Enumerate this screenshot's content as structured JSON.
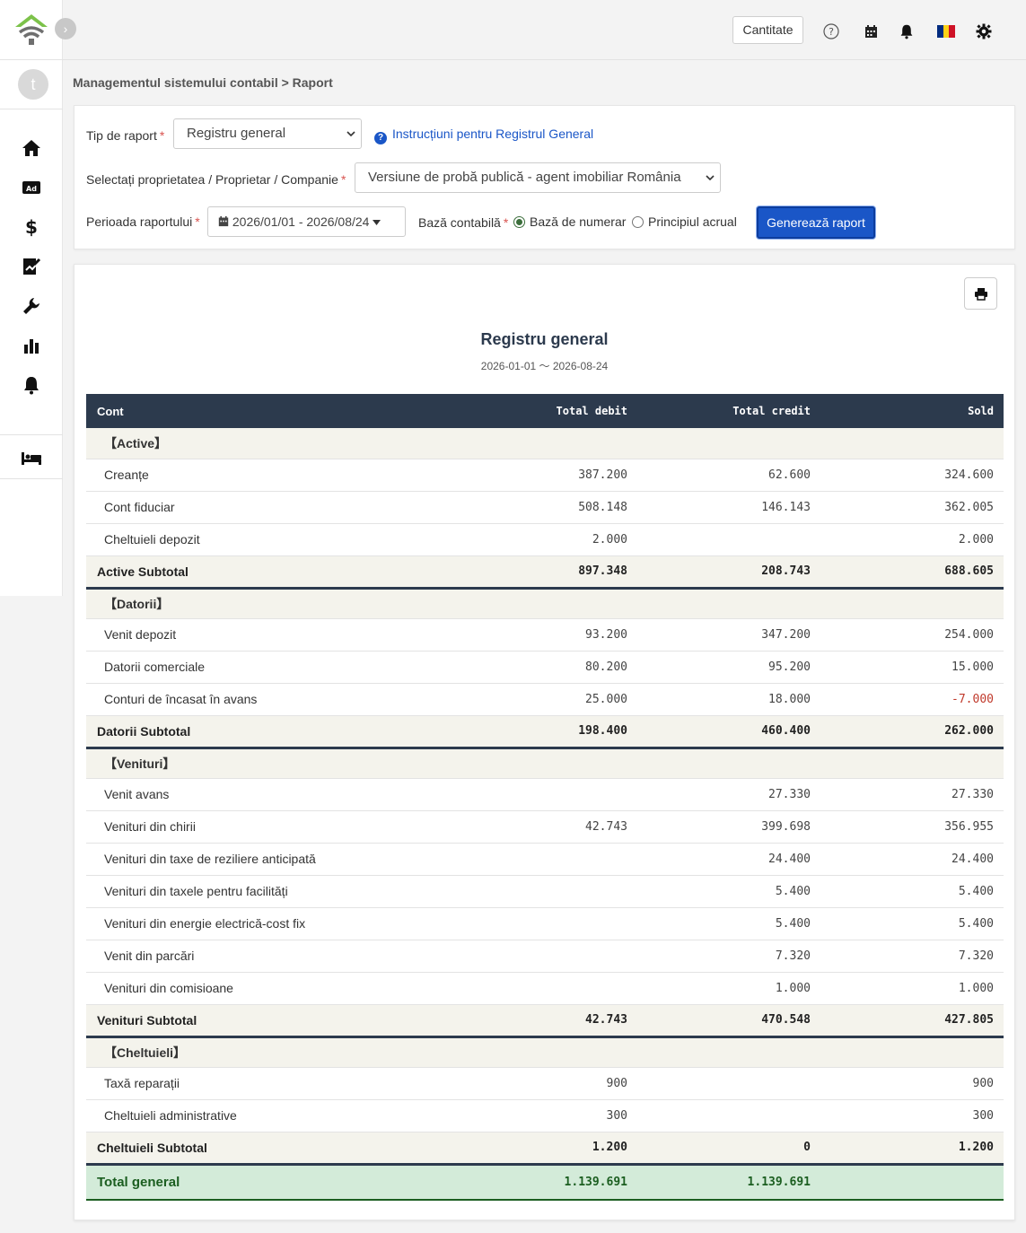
{
  "header": {
    "quantity_label": "Cantitate",
    "icons": [
      "help-icon",
      "calendar-icon",
      "bell-icon",
      "romania-flag-icon",
      "gear-icon"
    ]
  },
  "sidebar": {
    "avatar_letter": "t",
    "items": [
      "home-icon",
      "ad-icon",
      "dollar-icon",
      "signature-icon",
      "wrench-icon",
      "bar-chart-icon",
      "bell-icon",
      "bed-icon"
    ]
  },
  "breadcrumb": "Managementul sistemului contabil > Raport",
  "filters": {
    "report_type_label": "Tip de raport",
    "report_type_value": "Registru general",
    "help_link": "Instrucțiuni pentru Registrul General",
    "property_label": "Selectați proprietatea / Proprietar / Companie",
    "property_value": "Versiune de probă publică - agent imobiliar România",
    "period_label": "Perioada raportului",
    "period_value": "2026/01/01 - 2026/08/24",
    "basis_label": "Bază contabilă",
    "basis_cash": "Bază de numerar",
    "basis_accrual": "Principiul acrual",
    "generate_button": "Generează raport"
  },
  "report": {
    "title": "Registru general",
    "subtitle": "2026-01-01 〜 2026-08-24",
    "columns": {
      "account": "Cont",
      "debit": "Total debit",
      "credit": "Total credit",
      "balance": "Sold"
    },
    "sections": [
      {
        "title": "【Active】",
        "rows": [
          {
            "name": "Creanțe",
            "debit": "387.200",
            "credit": "62.600",
            "balance": "324.600"
          },
          {
            "name": "Cont fiduciar",
            "debit": "508.148",
            "credit": "146.143",
            "balance": "362.005"
          },
          {
            "name": "Cheltuieli depozit",
            "debit": "2.000",
            "credit": "",
            "balance": "2.000"
          }
        ],
        "subtotal": {
          "name": "Active Subtotal",
          "debit": "897.348",
          "credit": "208.743",
          "balance": "688.605"
        }
      },
      {
        "title": "【Datorii】",
        "rows": [
          {
            "name": "Venit depozit",
            "debit": "93.200",
            "credit": "347.200",
            "balance": "254.000"
          },
          {
            "name": "Datorii comerciale",
            "debit": "80.200",
            "credit": "95.200",
            "balance": "15.000"
          },
          {
            "name": "Conturi de încasat în avans",
            "debit": "25.000",
            "credit": "18.000",
            "balance": "-7.000",
            "negative": true
          }
        ],
        "subtotal": {
          "name": "Datorii Subtotal",
          "debit": "198.400",
          "credit": "460.400",
          "balance": "262.000"
        }
      },
      {
        "title": "【Venituri】",
        "rows": [
          {
            "name": "Venit avans",
            "debit": "",
            "credit": "27.330",
            "balance": "27.330"
          },
          {
            "name": "Venituri din chirii",
            "debit": "42.743",
            "credit": "399.698",
            "balance": "356.955"
          },
          {
            "name": "Venituri din taxe de reziliere anticipată",
            "debit": "",
            "credit": "24.400",
            "balance": "24.400"
          },
          {
            "name": "Venituri din taxele pentru facilități",
            "debit": "",
            "credit": "5.400",
            "balance": "5.400"
          },
          {
            "name": "Venituri din energie electrică-cost fix",
            "debit": "",
            "credit": "5.400",
            "balance": "5.400"
          },
          {
            "name": "Venit din parcări",
            "debit": "",
            "credit": "7.320",
            "balance": "7.320"
          },
          {
            "name": "Venituri din comisioane",
            "debit": "",
            "credit": "1.000",
            "balance": "1.000"
          }
        ],
        "subtotal": {
          "name": "Venituri Subtotal",
          "debit": "42.743",
          "credit": "470.548",
          "balance": "427.805"
        }
      },
      {
        "title": "【Cheltuieli】",
        "rows": [
          {
            "name": "Taxă reparații",
            "debit": "900",
            "credit": "",
            "balance": "900"
          },
          {
            "name": "Cheltuieli administrative",
            "debit": "300",
            "credit": "",
            "balance": "300"
          }
        ],
        "subtotal": {
          "name": "Cheltuieli Subtotal",
          "debit": "1.200",
          "credit": "0",
          "balance": "1.200"
        }
      }
    ],
    "grand_total": {
      "name": "Total general",
      "debit": "1.139.691",
      "credit": "1.139.691",
      "balance": ""
    }
  },
  "colors": {
    "primary": "#1a56c7",
    "table_header": "#2c3a4d",
    "section_bg": "#f4f3ec",
    "total_bg": "#d3ebd9",
    "total_text": "#1b5e20",
    "negative": "#c0392b"
  }
}
